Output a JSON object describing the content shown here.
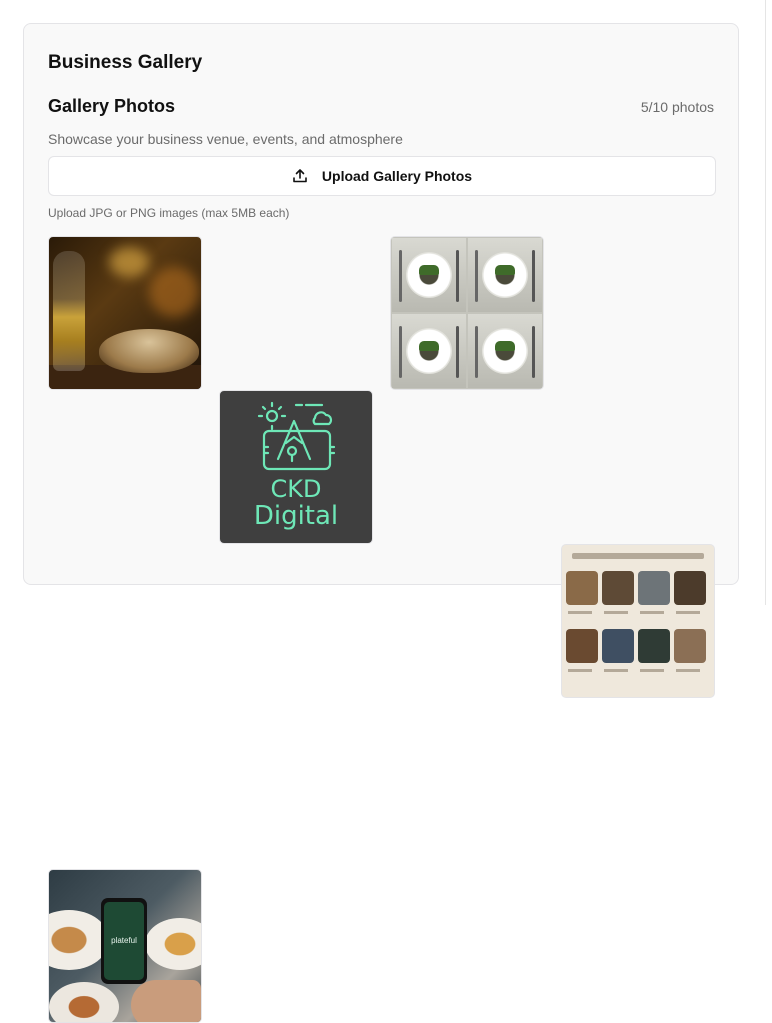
{
  "card": {
    "title": "Business Gallery"
  },
  "gallery": {
    "title": "Gallery Photos",
    "count": "5/10 photos",
    "description": "Showcase your business venue, events, and atmosphere",
    "upload_button": "Upload Gallery Photos",
    "hint": "Upload JPG or PNG images (max 5MB each)",
    "photos": [
      {
        "alt": "wine-and-dinner-photo"
      },
      {
        "alt": "ckd-digital-logo",
        "text_line1": "CKD",
        "text_line2": "Digital"
      },
      {
        "alt": "plated-dishes-photo"
      },
      {
        "alt": "restaurant-collage-photo"
      },
      {
        "alt": "phone-app-photo",
        "screen_text": "plateful"
      }
    ]
  },
  "colors": {
    "card_bg": "#f9f9f9",
    "border": "#e4e4e7",
    "muted_text": "#6b6b6b",
    "logo_green": "#6ee7b7"
  }
}
